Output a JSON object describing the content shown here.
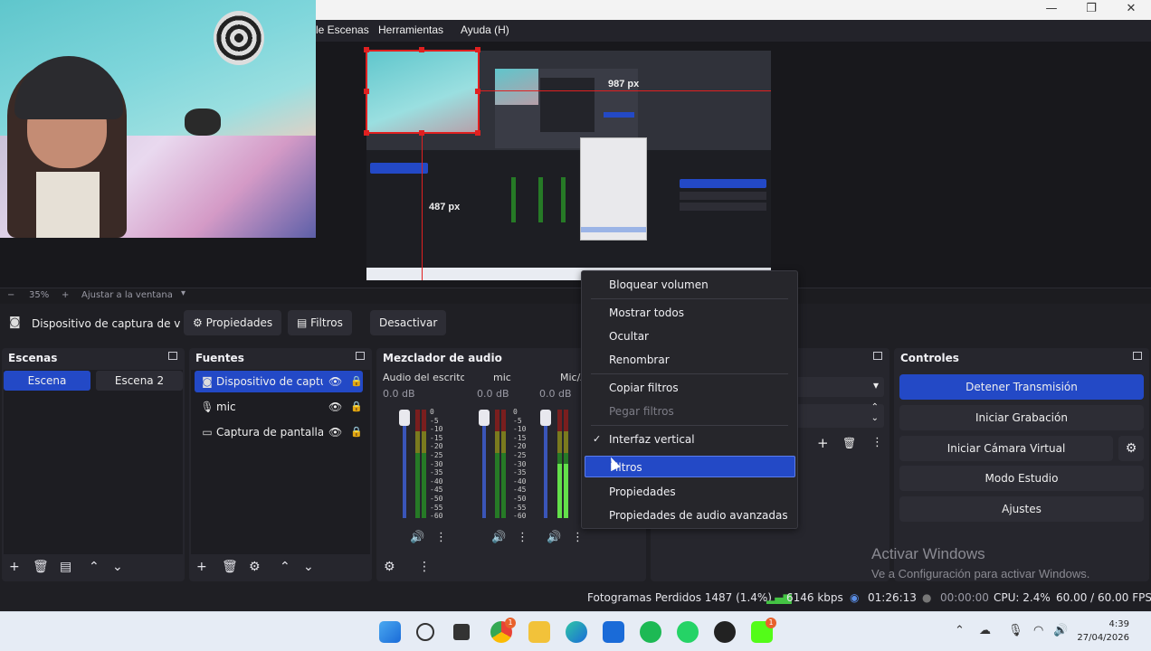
{
  "menu": {
    "items": [
      "le Escenas",
      "Herramientas",
      "Ayuda (H)"
    ]
  },
  "window": {
    "minimize": "—",
    "maximize": "❐",
    "close": "✕"
  },
  "preview": {
    "dist_horizontal": "987 px",
    "dist_vertical": "487 px",
    "zoom_minus": "−",
    "zoom_value": "35%",
    "zoom_plus": "+",
    "fit_label": "Ajustar a la ventana"
  },
  "context_toolbar": {
    "source_name": "Dispositivo de captura de v",
    "properties": "Propiedades",
    "filters": "Filtros",
    "deactivate": "Desactivar"
  },
  "scenes": {
    "title": "Escenas",
    "items": [
      {
        "label": "Escena",
        "selected": true
      },
      {
        "label": "Escena 2",
        "selected": false
      }
    ]
  },
  "sources": {
    "title": "Fuentes",
    "items": [
      {
        "label": "Dispositivo de captur",
        "icon": "camera-icon",
        "selected": true
      },
      {
        "label": "mic",
        "icon": "microphone-icon",
        "selected": false
      },
      {
        "label": "Captura de pantalla",
        "icon": "monitor-icon",
        "selected": false
      }
    ]
  },
  "mixer": {
    "title": "Mezclador de audio",
    "channels": [
      {
        "name": "Audio del escritorio",
        "db": "0.0 dB",
        "level": 0.0
      },
      {
        "name": "mic",
        "db": "0.0 dB",
        "level": 0.0
      },
      {
        "name": "Mic/Aux",
        "db": "0.0 dB",
        "level": 0.5
      }
    ],
    "ticks": [
      "0",
      "-5",
      "-10",
      "-15",
      "-20",
      "-25",
      "-30",
      "-35",
      "-40",
      "-45",
      "-50",
      "-55",
      "-60"
    ]
  },
  "context_menu": {
    "items": [
      {
        "label": "Bloquear volumen",
        "state": "normal"
      },
      {
        "label": "Mostrar todos",
        "state": "normal"
      },
      {
        "label": "Ocultar",
        "state": "normal"
      },
      {
        "label": "Renombrar",
        "state": "normal"
      },
      {
        "label": "Copiar filtros",
        "state": "normal"
      },
      {
        "label": "Pegar filtros",
        "state": "disabled"
      },
      {
        "label": "Interfaz vertical",
        "state": "checked"
      },
      {
        "label": "Filtros",
        "state": "highlighted"
      },
      {
        "label": "Propiedades",
        "state": "normal"
      },
      {
        "label": "Propiedades de audio avanzadas",
        "state": "normal"
      }
    ]
  },
  "controls": {
    "title": "Controles",
    "stop_stream": "Detener Transmisión",
    "start_recording": "Iniciar Grabación",
    "start_virtual_cam": "Iniciar Cámara Virtual",
    "studio_mode": "Modo Estudio",
    "settings": "Ajustes"
  },
  "watermark": {
    "line1": "Activar Windows",
    "line2": "Ve a Configuración para activar Windows."
  },
  "status": {
    "dropped_frames": "Fotogramas Perdidos 1487 (1.4%)",
    "bitrate": "6146 kbps",
    "stream_time": "01:26:13",
    "record_time": "00:00:00",
    "cpu": "CPU: 2.4%",
    "fps": "60.00 / 60.00 FPS"
  },
  "taskbar": {
    "time": "4:39",
    "date": "27/04/2026",
    "chrome_badge": "1",
    "app_badge": "1",
    "colors": {
      "bg": "#e6ecf5",
      "accent": "#2349c6"
    }
  }
}
